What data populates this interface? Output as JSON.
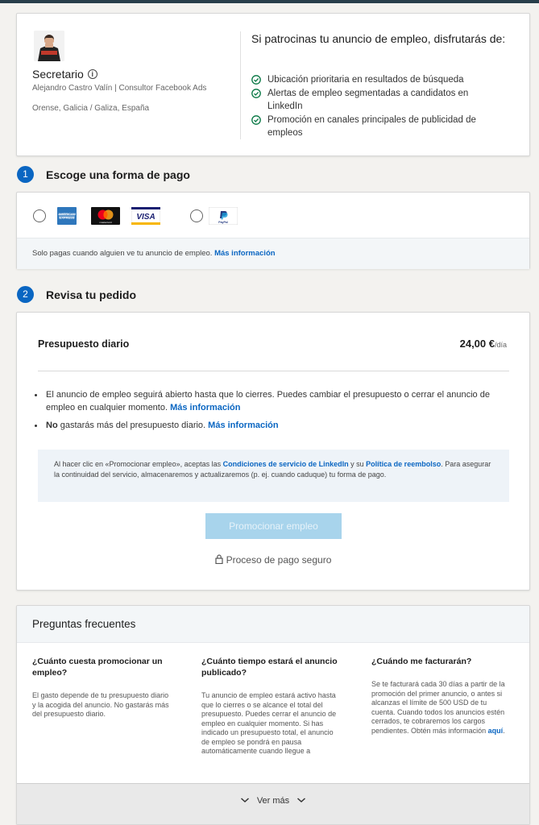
{
  "job": {
    "title": "Secretario",
    "info_icon": "i",
    "company": "Alejandro Castro Valín | Consultor Facebook Ads",
    "location": "Orense, Galicia / Galiza, España"
  },
  "benefits": {
    "title": "Si patrocinas tu anuncio de empleo, disfrutarás de:",
    "items": [
      "Ubicación prioritaria en resultados de búsqueda",
      "Alertas de empleo segmentadas a candidatos en LinkedIn",
      "Promoción en canales principales de publicidad de empleos"
    ]
  },
  "payment": {
    "step": "1",
    "heading": "Escoge una forma de pago",
    "cards": [
      "American Express",
      "mastercard",
      "VISA"
    ],
    "paypal": "PayPal",
    "footer_text": "Solo pagas cuando alguien ve tu anuncio de empleo.",
    "footer_link": "Más información"
  },
  "order": {
    "step": "2",
    "heading": "Revisa tu pedido",
    "budget_label": "Presupuesto diario",
    "budget_value": "24,00 €",
    "budget_unit": "/día",
    "bullet1_text": "El anuncio de empleo seguirá abierto hasta que lo cierres. Puedes cambiar el presupuesto o cerrar el anuncio de empleo en cualquier momento.",
    "bullet1_link": "Más información",
    "bullet2_bold": "No",
    "bullet2_text": " gastarás más del presupuesto diario.",
    "bullet2_link": "Más información",
    "terms_pre": "Al hacer clic en «Promocionar empleo», aceptas las ",
    "terms_link1": "Condiciones de servicio de LinkedIn",
    "terms_mid": " y su ",
    "terms_link2": "Política de reembolso",
    "terms_post": ". Para asegurar la continuidad del servicio, almacenaremos y actualizaremos (p. ej. cuando caduque) tu forma de pago.",
    "button": "Promocionar empleo",
    "secure": "Proceso de pago seguro"
  },
  "faq": {
    "title": "Preguntas frecuentes",
    "items": [
      {
        "q": "¿Cuánto cuesta promocionar un empleo?",
        "a": "El gasto depende de tu presupuesto diario y la acogida del anuncio. No gastarás más del presupuesto diario."
      },
      {
        "q": "¿Cuánto tiempo estará el anuncio publicado?",
        "a": "Tu anuncio de empleo estará activo hasta que lo cierres o se alcance el total del presupuesto. Puedes cerrar el anuncio de empleo en cualquier momento. Si has indicado un presupuesto total, el anuncio de empleo se pondrá en pausa automáticamente cuando llegue a"
      },
      {
        "q": "¿Cuándo me facturarán?",
        "a": "Se te facturará cada 30 días a partir de la promoción del primer anuncio, o antes si alcanzas el límite de 500 USD de tu cuenta. Cuando todos los anuncios estén cerrados, te cobraremos los cargos pendientes. Obtén más información ",
        "link": "aquí"
      }
    ],
    "see_more": "Ver más"
  },
  "colors": {
    "accent": "#0a66c2",
    "button_disabled": "#a8d4ec",
    "check": "#057642"
  }
}
